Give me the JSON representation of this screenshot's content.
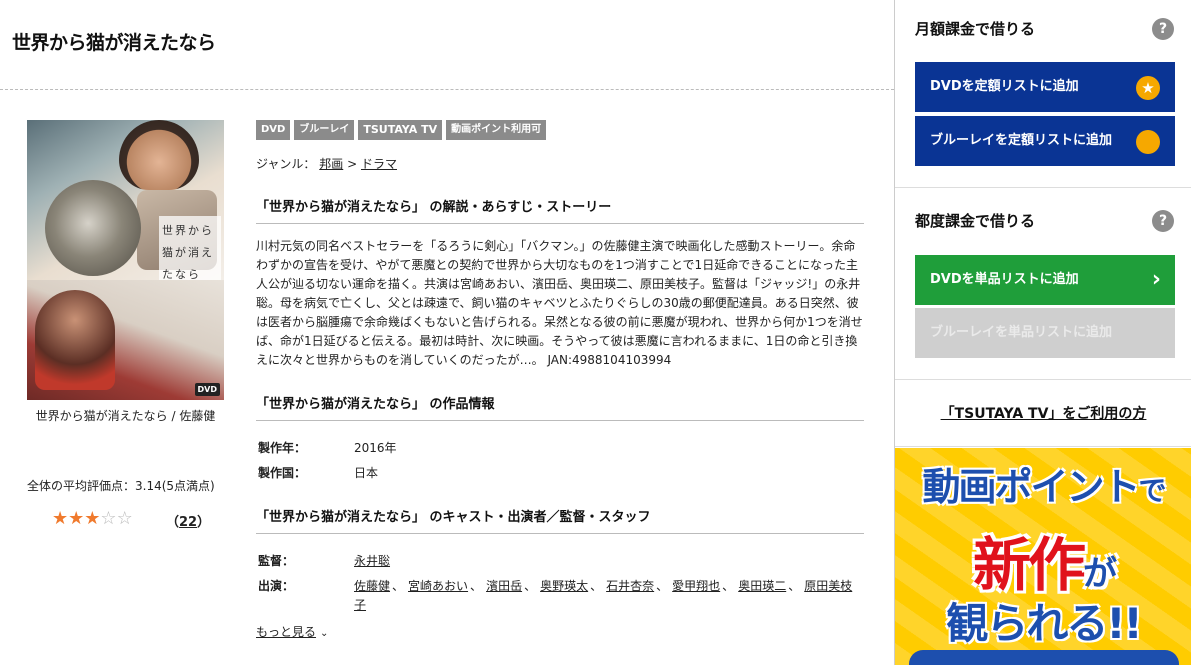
{
  "title": "世界から猫が消えたなら",
  "cover": {
    "caption_line1": "世界から",
    "caption_line2": "猫が消え",
    "caption_line3": "たなら",
    "dvd_mark": "DVD",
    "label": "世界から猫が消えたなら / 佐藤健"
  },
  "rating": {
    "text": "全体の平均評価点：3.14(5点満点)",
    "stars_filled": 3,
    "stars_total": 5,
    "count": "22",
    "count_open": "（",
    "count_close": "）"
  },
  "badges": [
    "DVD",
    "ブルーレイ",
    "TSUTAYA TV",
    "動画ポイント利用可"
  ],
  "genre": {
    "label": "ジャンル：",
    "level1": "邦画",
    "sep": ">",
    "level2": "ドラマ"
  },
  "story": {
    "heading": "「世界から猫が消えたなら」 の解説・あらすじ・ストーリー",
    "text": "川村元気の同名ベストセラーを「るろうに剣心」「バクマン。」の佐藤健主演で映画化した感動ストーリー。余命わずかの宣告を受け、やがて悪魔との契約で世界から大切なものを1つ消すことで1日延命できることになった主人公が辿る切ない運命を描く。共演は宮崎あおい、濱田岳、奥田瑛二、原田美枝子。監督は「ジャッジ!」の永井聡。母を病気で亡くし、父とは疎遠で、飼い猫のキャベツとふたりぐらしの30歳の郵便配達員。ある日突然、彼は医者から脳腫瘍で余命幾ばくもないと告げられる。呆然となる彼の前に悪魔が現われ、世界から何か1つを消せば、命が1日延びると伝える。最初は時計、次に映画。そうやって彼は悪魔に言われるままに、1日の命と引き換えに次々と世界からものを消していくのだったが…。 JAN:4988104103994"
  },
  "info": {
    "heading": "「世界から猫が消えたなら」 の作品情報",
    "year_label": "製作年：",
    "year": "2016年",
    "country_label": "製作国：",
    "country": "日本"
  },
  "cast": {
    "heading": "「世界から猫が消えたなら」 のキャスト・出演者／監督・スタッフ",
    "director_label": "監督：",
    "director": "永井聡",
    "cast_label": "出演：",
    "members": [
      "佐藤健",
      "宮崎あおい",
      "濱田岳",
      "奥野瑛太",
      "石井杏奈",
      "愛甲翔也",
      "奥田瑛二",
      "原田美枝子"
    ],
    "separator": "、",
    "more": "もっと見る"
  },
  "sidebar": {
    "monthly_heading": "月額課金で借りる",
    "help": "?",
    "dvd_monthly": "DVDを定額リストに追加",
    "bd_monthly": "ブルーレイを定額リストに追加",
    "single_heading": "都度課金で借りる",
    "dvd_single": "DVDを単品リストに追加",
    "bd_single": "ブルーレイを単品リストに追加",
    "tv_link": "「TSUTAYA TV」をご利用の方"
  },
  "banner": {
    "line1": "動画ポイント",
    "line1_suffix": "で",
    "line2": "新作",
    "line2_suffix": "が",
    "line3": "観られる!!"
  },
  "colors": {
    "blue_button": "#0a3494",
    "green_button": "#1f9e3a",
    "disabled_button": "#cfcfcf",
    "star": "#f07a2d",
    "badge": "#8b8b8b"
  }
}
